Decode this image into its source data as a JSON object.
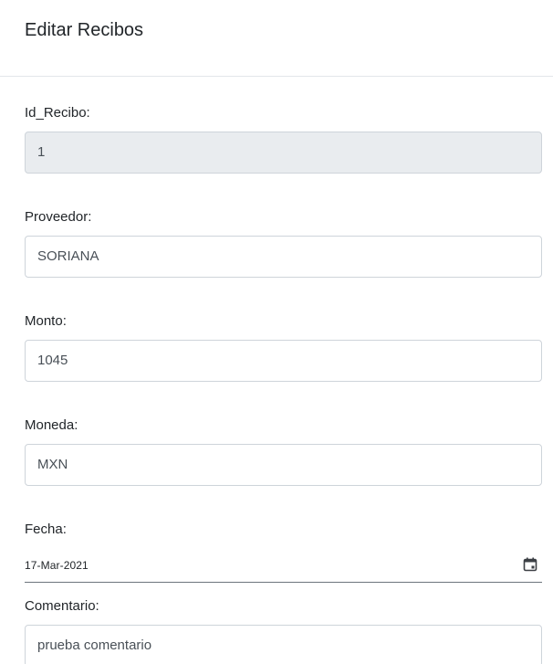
{
  "modal": {
    "title": "Editar Recibos"
  },
  "fields": {
    "id_recibo": {
      "label": "Id_Recibo:",
      "value": "1"
    },
    "proveedor": {
      "label": "Proveedor:",
      "value": "SORIANA"
    },
    "monto": {
      "label": "Monto:",
      "value": "1045"
    },
    "moneda": {
      "label": "Moneda:",
      "value": "MXN"
    },
    "fecha": {
      "label": "Fecha:",
      "value": "17-Mar-2021",
      "icon": "calendar-icon"
    },
    "comentario": {
      "label": "Comentario:",
      "value": "prueba comentario"
    }
  }
}
